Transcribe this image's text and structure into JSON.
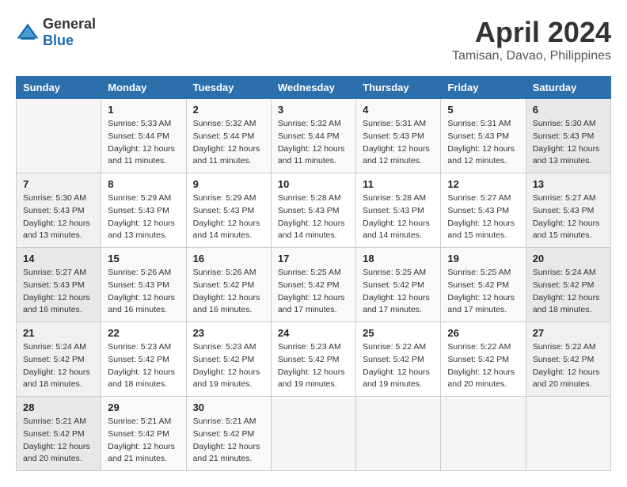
{
  "header": {
    "logo_general": "General",
    "logo_blue": "Blue",
    "month_title": "April 2024",
    "location": "Tamisan, Davao, Philippines"
  },
  "days_of_week": [
    "Sunday",
    "Monday",
    "Tuesday",
    "Wednesday",
    "Thursday",
    "Friday",
    "Saturday"
  ],
  "weeks": [
    [
      {
        "day": "",
        "sunrise": "",
        "sunset": "",
        "daylight": ""
      },
      {
        "day": "1",
        "sunrise": "Sunrise: 5:33 AM",
        "sunset": "Sunset: 5:44 PM",
        "daylight": "Daylight: 12 hours and 11 minutes."
      },
      {
        "day": "2",
        "sunrise": "Sunrise: 5:32 AM",
        "sunset": "Sunset: 5:44 PM",
        "daylight": "Daylight: 12 hours and 11 minutes."
      },
      {
        "day": "3",
        "sunrise": "Sunrise: 5:32 AM",
        "sunset": "Sunset: 5:44 PM",
        "daylight": "Daylight: 12 hours and 11 minutes."
      },
      {
        "day": "4",
        "sunrise": "Sunrise: 5:31 AM",
        "sunset": "Sunset: 5:43 PM",
        "daylight": "Daylight: 12 hours and 12 minutes."
      },
      {
        "day": "5",
        "sunrise": "Sunrise: 5:31 AM",
        "sunset": "Sunset: 5:43 PM",
        "daylight": "Daylight: 12 hours and 12 minutes."
      },
      {
        "day": "6",
        "sunrise": "Sunrise: 5:30 AM",
        "sunset": "Sunset: 5:43 PM",
        "daylight": "Daylight: 12 hours and 13 minutes."
      }
    ],
    [
      {
        "day": "7",
        "sunrise": "Sunrise: 5:30 AM",
        "sunset": "Sunset: 5:43 PM",
        "daylight": "Daylight: 12 hours and 13 minutes."
      },
      {
        "day": "8",
        "sunrise": "Sunrise: 5:29 AM",
        "sunset": "Sunset: 5:43 PM",
        "daylight": "Daylight: 12 hours and 13 minutes."
      },
      {
        "day": "9",
        "sunrise": "Sunrise: 5:29 AM",
        "sunset": "Sunset: 5:43 PM",
        "daylight": "Daylight: 12 hours and 14 minutes."
      },
      {
        "day": "10",
        "sunrise": "Sunrise: 5:28 AM",
        "sunset": "Sunset: 5:43 PM",
        "daylight": "Daylight: 12 hours and 14 minutes."
      },
      {
        "day": "11",
        "sunrise": "Sunrise: 5:28 AM",
        "sunset": "Sunset: 5:43 PM",
        "daylight": "Daylight: 12 hours and 14 minutes."
      },
      {
        "day": "12",
        "sunrise": "Sunrise: 5:27 AM",
        "sunset": "Sunset: 5:43 PM",
        "daylight": "Daylight: 12 hours and 15 minutes."
      },
      {
        "day": "13",
        "sunrise": "Sunrise: 5:27 AM",
        "sunset": "Sunset: 5:43 PM",
        "daylight": "Daylight: 12 hours and 15 minutes."
      }
    ],
    [
      {
        "day": "14",
        "sunrise": "Sunrise: 5:27 AM",
        "sunset": "Sunset: 5:43 PM",
        "daylight": "Daylight: 12 hours and 16 minutes."
      },
      {
        "day": "15",
        "sunrise": "Sunrise: 5:26 AM",
        "sunset": "Sunset: 5:43 PM",
        "daylight": "Daylight: 12 hours and 16 minutes."
      },
      {
        "day": "16",
        "sunrise": "Sunrise: 5:26 AM",
        "sunset": "Sunset: 5:42 PM",
        "daylight": "Daylight: 12 hours and 16 minutes."
      },
      {
        "day": "17",
        "sunrise": "Sunrise: 5:25 AM",
        "sunset": "Sunset: 5:42 PM",
        "daylight": "Daylight: 12 hours and 17 minutes."
      },
      {
        "day": "18",
        "sunrise": "Sunrise: 5:25 AM",
        "sunset": "Sunset: 5:42 PM",
        "daylight": "Daylight: 12 hours and 17 minutes."
      },
      {
        "day": "19",
        "sunrise": "Sunrise: 5:25 AM",
        "sunset": "Sunset: 5:42 PM",
        "daylight": "Daylight: 12 hours and 17 minutes."
      },
      {
        "day": "20",
        "sunrise": "Sunrise: 5:24 AM",
        "sunset": "Sunset: 5:42 PM",
        "daylight": "Daylight: 12 hours and 18 minutes."
      }
    ],
    [
      {
        "day": "21",
        "sunrise": "Sunrise: 5:24 AM",
        "sunset": "Sunset: 5:42 PM",
        "daylight": "Daylight: 12 hours and 18 minutes."
      },
      {
        "day": "22",
        "sunrise": "Sunrise: 5:23 AM",
        "sunset": "Sunset: 5:42 PM",
        "daylight": "Daylight: 12 hours and 18 minutes."
      },
      {
        "day": "23",
        "sunrise": "Sunrise: 5:23 AM",
        "sunset": "Sunset: 5:42 PM",
        "daylight": "Daylight: 12 hours and 19 minutes."
      },
      {
        "day": "24",
        "sunrise": "Sunrise: 5:23 AM",
        "sunset": "Sunset: 5:42 PM",
        "daylight": "Daylight: 12 hours and 19 minutes."
      },
      {
        "day": "25",
        "sunrise": "Sunrise: 5:22 AM",
        "sunset": "Sunset: 5:42 PM",
        "daylight": "Daylight: 12 hours and 19 minutes."
      },
      {
        "day": "26",
        "sunrise": "Sunrise: 5:22 AM",
        "sunset": "Sunset: 5:42 PM",
        "daylight": "Daylight: 12 hours and 20 minutes."
      },
      {
        "day": "27",
        "sunrise": "Sunrise: 5:22 AM",
        "sunset": "Sunset: 5:42 PM",
        "daylight": "Daylight: 12 hours and 20 minutes."
      }
    ],
    [
      {
        "day": "28",
        "sunrise": "Sunrise: 5:21 AM",
        "sunset": "Sunset: 5:42 PM",
        "daylight": "Daylight: 12 hours and 20 minutes."
      },
      {
        "day": "29",
        "sunrise": "Sunrise: 5:21 AM",
        "sunset": "Sunset: 5:42 PM",
        "daylight": "Daylight: 12 hours and 21 minutes."
      },
      {
        "day": "30",
        "sunrise": "Sunrise: 5:21 AM",
        "sunset": "Sunset: 5:42 PM",
        "daylight": "Daylight: 12 hours and 21 minutes."
      },
      {
        "day": "",
        "sunrise": "",
        "sunset": "",
        "daylight": ""
      },
      {
        "day": "",
        "sunrise": "",
        "sunset": "",
        "daylight": ""
      },
      {
        "day": "",
        "sunrise": "",
        "sunset": "",
        "daylight": ""
      },
      {
        "day": "",
        "sunrise": "",
        "sunset": "",
        "daylight": ""
      }
    ]
  ]
}
